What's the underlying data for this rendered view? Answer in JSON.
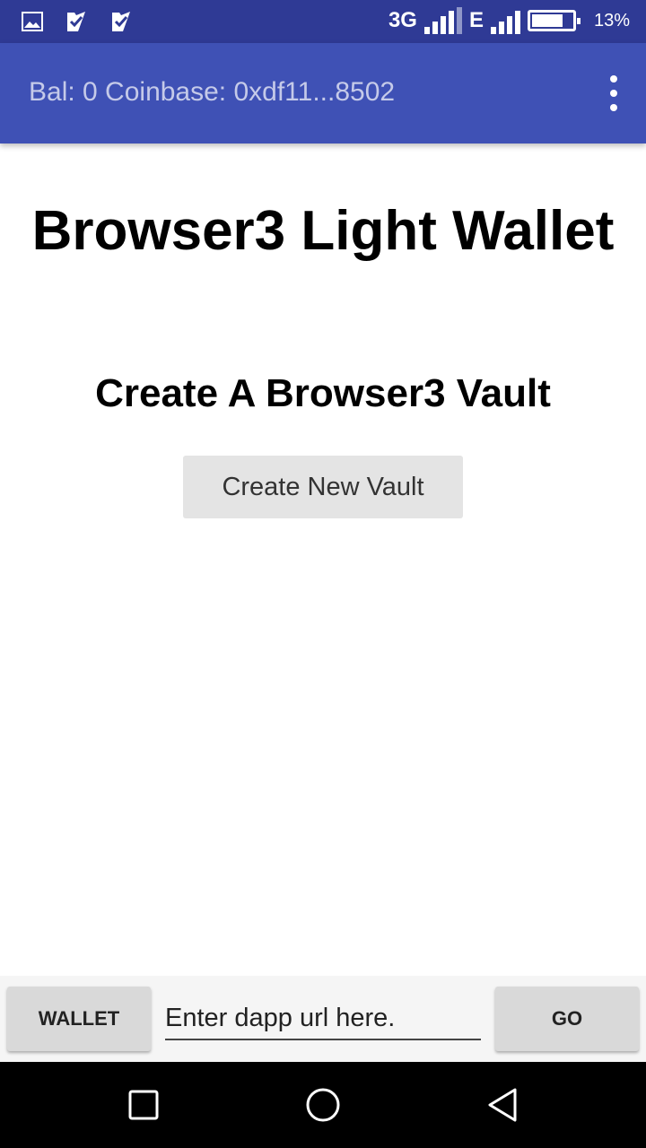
{
  "status_bar": {
    "network_1": "3G",
    "network_2": "E",
    "battery_percent": "13%",
    "battery_level": 0.8,
    "icons": [
      "image-icon",
      "check-ticket-icon",
      "check-ticket-icon"
    ]
  },
  "app_bar": {
    "title": "Bal: 0 Coinbase: 0xdf11...8502",
    "menu_icon": "more-vert-icon"
  },
  "main": {
    "title": "Browser3 Light Wallet",
    "section_title": "Create A Browser3 Vault",
    "create_button": "Create New Vault"
  },
  "bottom_bar": {
    "wallet_button": "WALLET",
    "url_placeholder": "Enter dapp url here.",
    "url_value": "",
    "go_button": "GO"
  },
  "nav_bar": {
    "icons": [
      "recent-apps-icon",
      "home-icon",
      "back-icon"
    ]
  },
  "colors": {
    "status_bar": "#2f3a95",
    "app_bar": "#3f51b5",
    "app_bar_text": "#c5cae9"
  }
}
